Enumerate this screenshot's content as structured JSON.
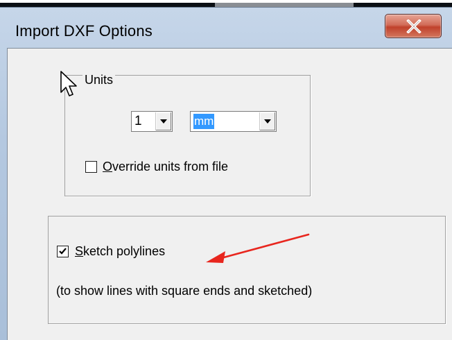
{
  "window": {
    "title": "Import DXF Options",
    "close_icon": "close-x-icon"
  },
  "units_group": {
    "legend": "Units",
    "quantity": {
      "value": "1"
    },
    "unit": {
      "value": "mm"
    },
    "override": {
      "label": "Override units from file",
      "checked": false
    }
  },
  "sketch_group": {
    "sketch_polylines": {
      "label": "Sketch polylines",
      "checked": true
    },
    "hint": "(to show lines with square ends and sketched)"
  },
  "annotation": {
    "icon": "red-arrow-icon",
    "color": "#e8261e"
  },
  "cursor_icon": "mouse-pointer-icon"
}
